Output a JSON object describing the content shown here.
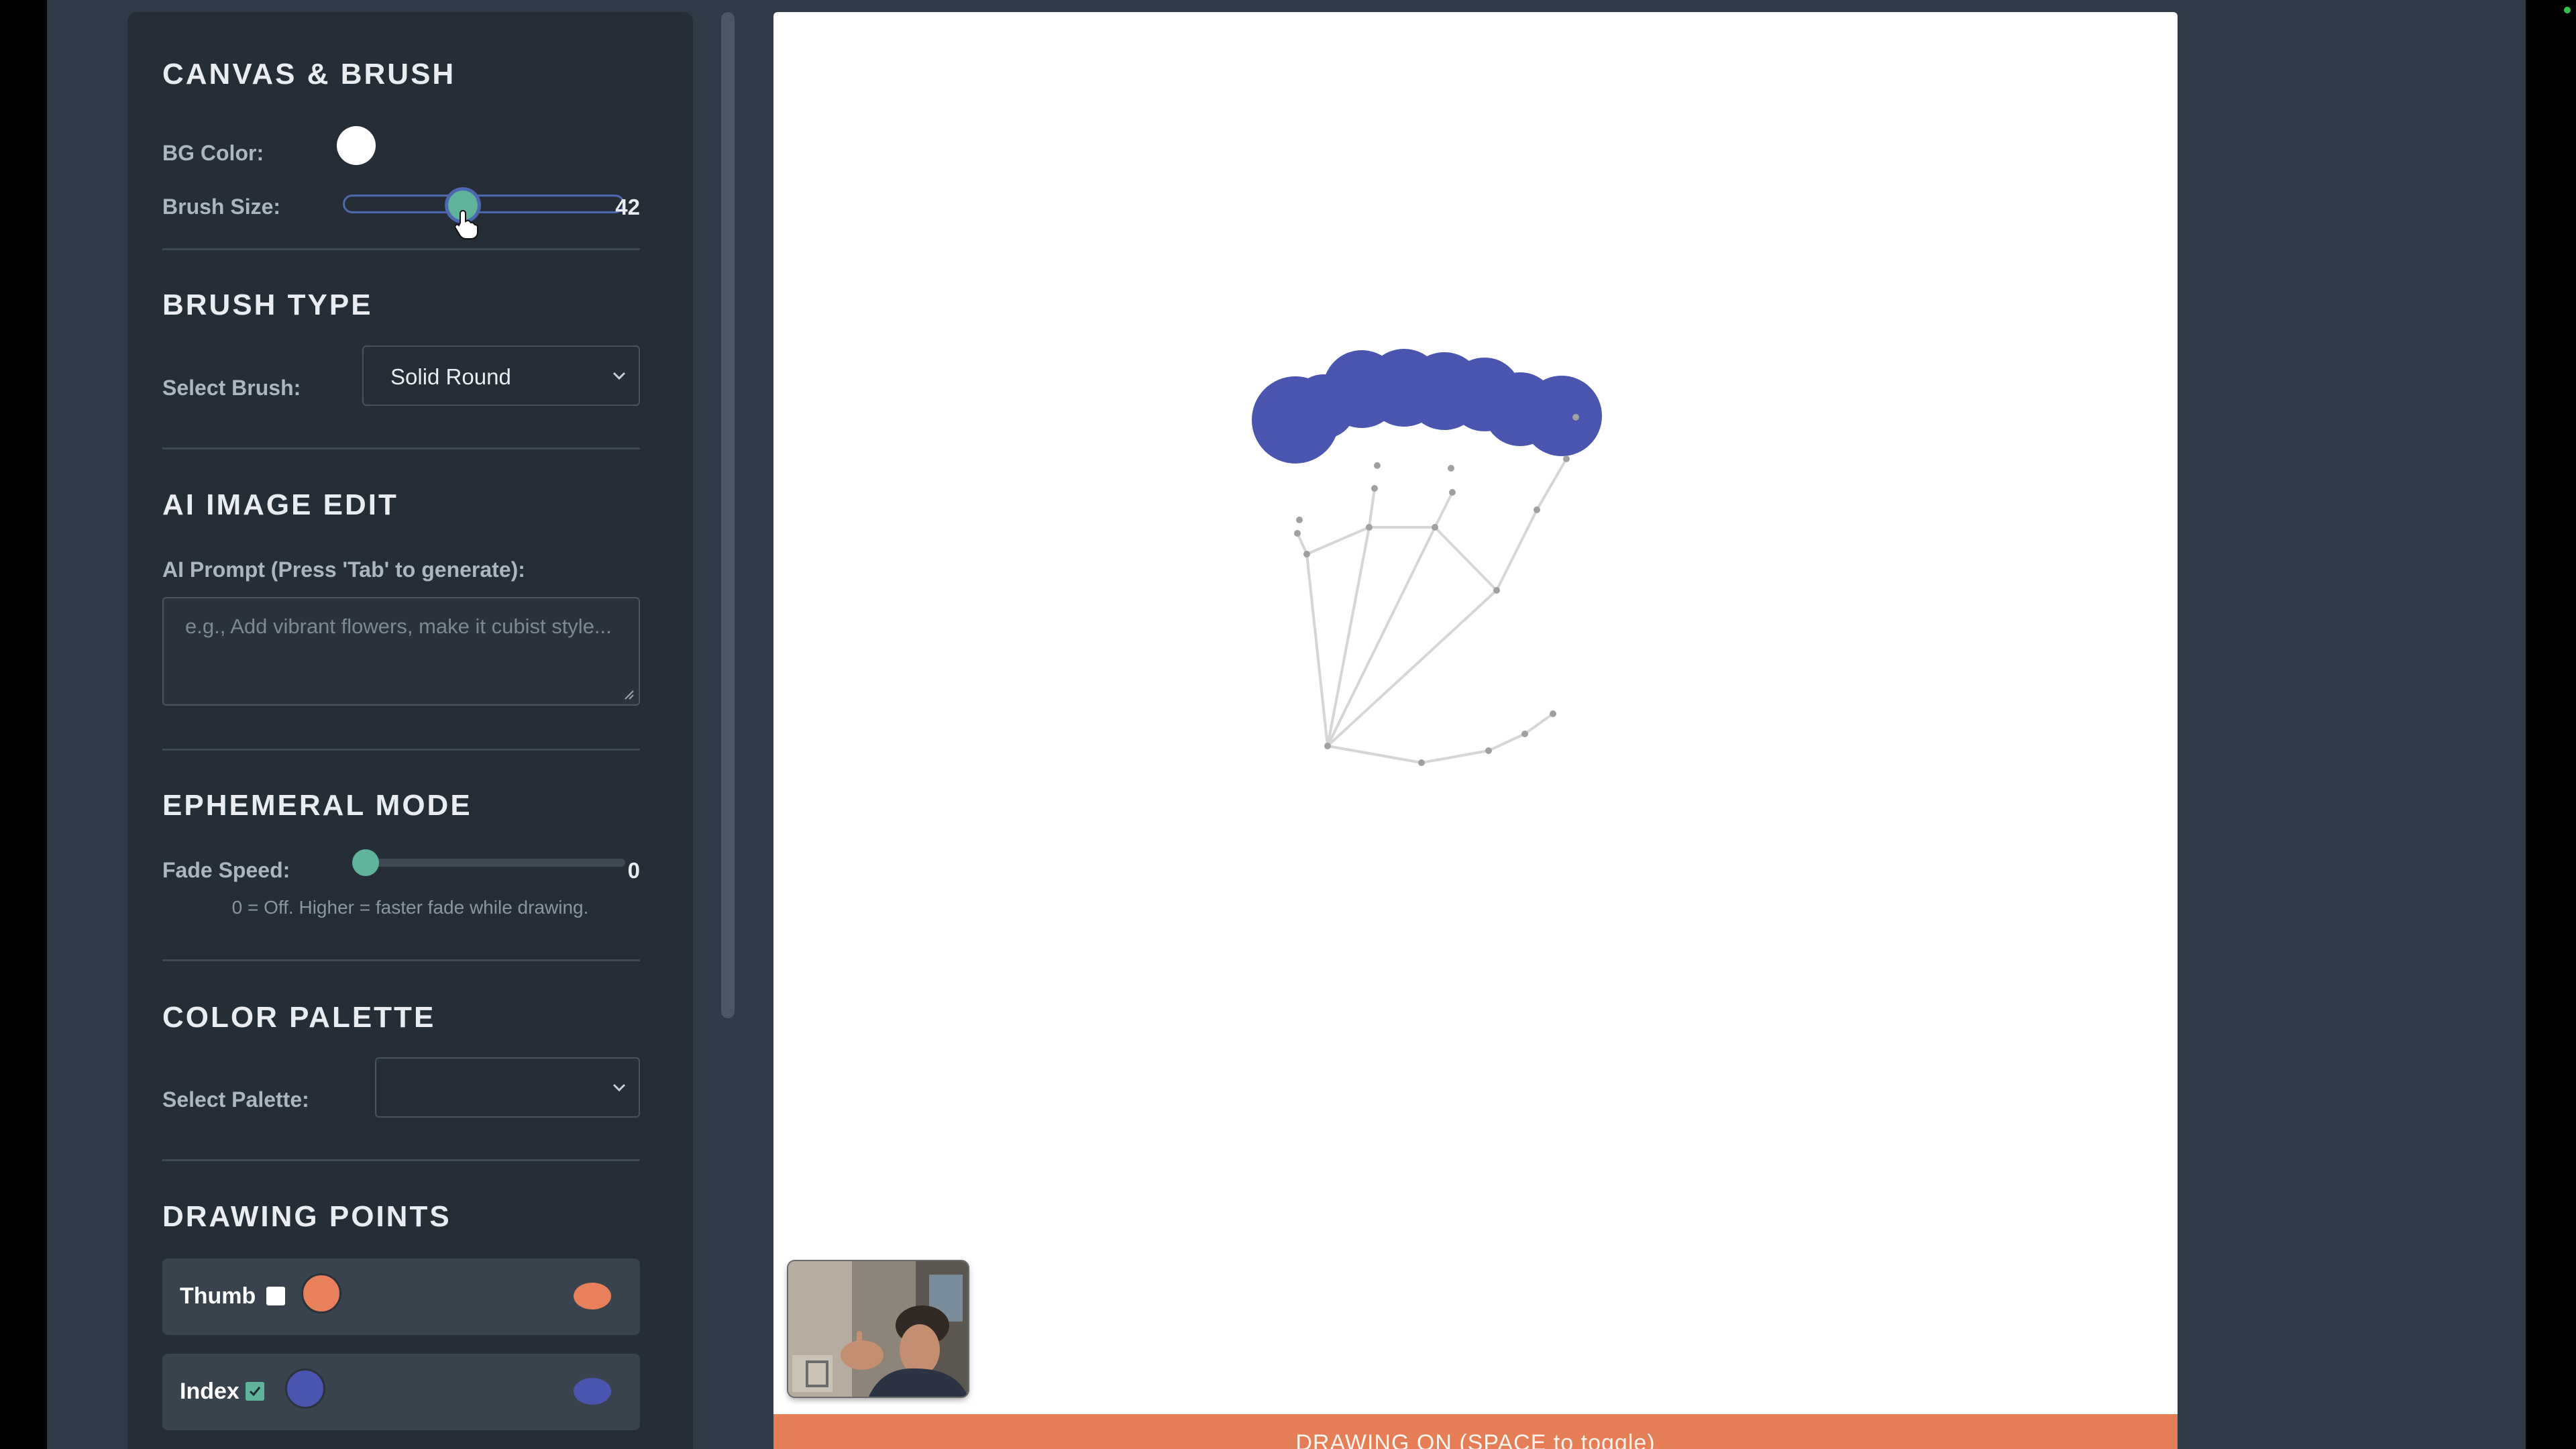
{
  "sidebar": {
    "canvas_brush": {
      "title": "CANVAS & BRUSH",
      "bg_color_label": "BG Color:",
      "bg_color": "#ffffff",
      "brush_size_label": "Brush Size:",
      "brush_size_value": "42",
      "brush_size_fraction": 0.42
    },
    "brush_type": {
      "title": "BRUSH TYPE",
      "select_label": "Select Brush:",
      "selected": "Solid Round"
    },
    "ai_edit": {
      "title": "AI IMAGE EDIT",
      "prompt_label": "AI Prompt (Press 'Tab' to generate):",
      "placeholder": "e.g., Add vibrant flowers, make it cubist style..."
    },
    "ephemeral": {
      "title": "EPHEMERAL MODE",
      "fade_label": "Fade Speed:",
      "fade_value": "0",
      "note": "0 = Off. Higher = faster fade while drawing."
    },
    "palette": {
      "title": "COLOR PALETTE",
      "select_label": "Select Palette:",
      "selected": ""
    },
    "drawing_points": {
      "title": "DRAWING POINTS",
      "items": [
        {
          "label": "Thumb",
          "checked": false,
          "color": "#e8805b"
        },
        {
          "label": "Index",
          "checked": true,
          "color": "#4a55b0"
        }
      ]
    }
  },
  "colors": {
    "accent": "#5fb39a",
    "brush": "#4a55b0",
    "status_bar": "#e57d56",
    "sidebar_bg": "#252d36",
    "app_bg": "#2f3a46"
  },
  "status": {
    "text": "DRAWING ON (SPACE to toggle)"
  },
  "icons": {
    "chevron": "chevron-down-icon",
    "cursor": "pointer-hand-icon"
  }
}
